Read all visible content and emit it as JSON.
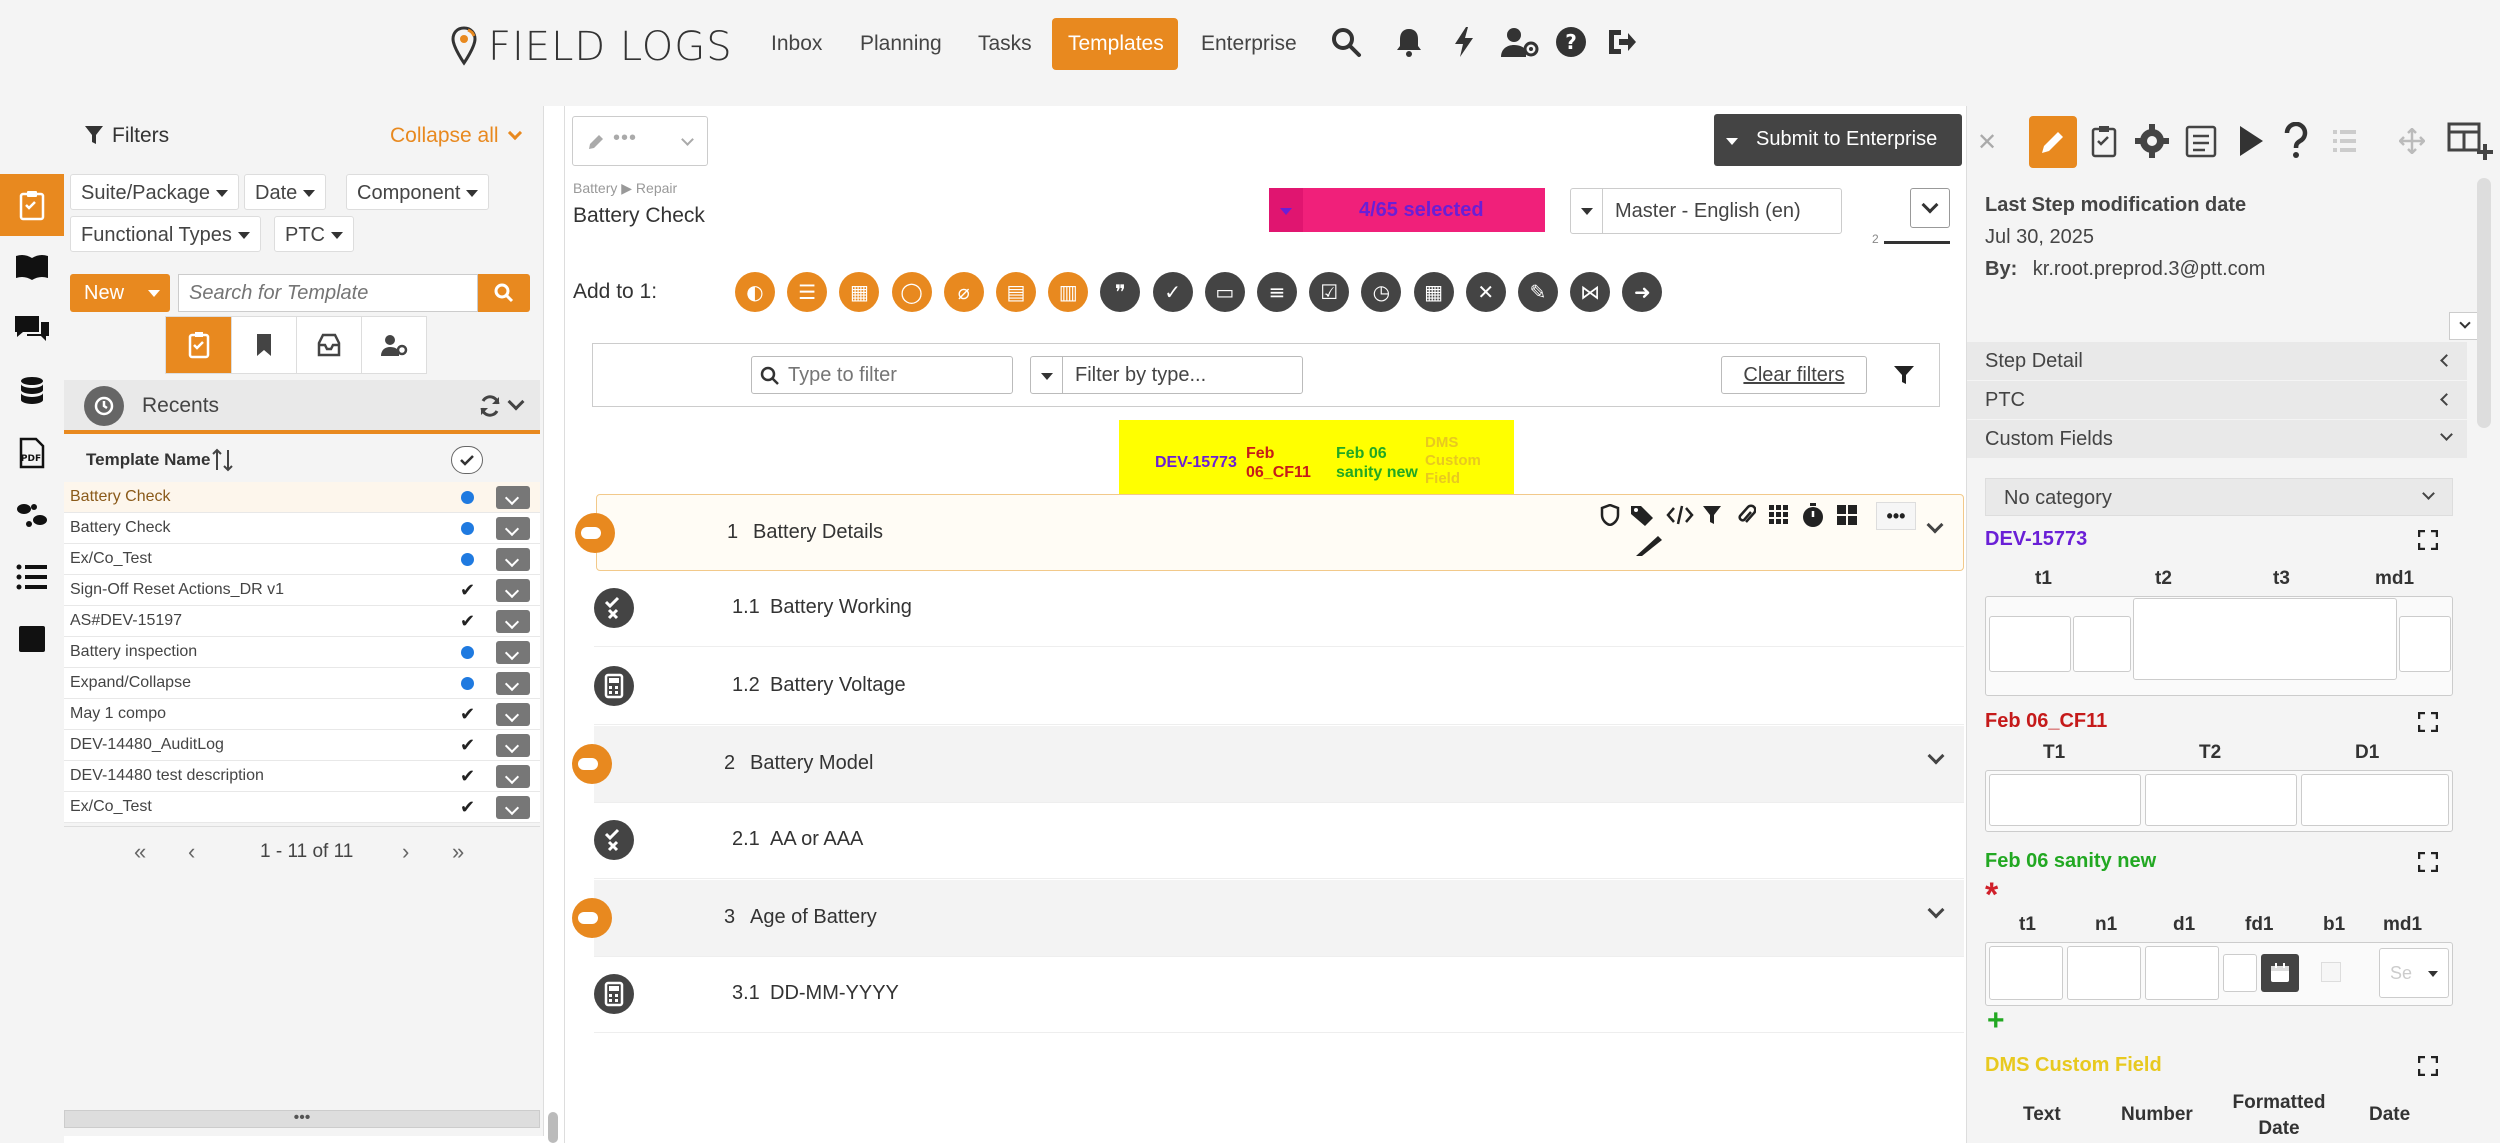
{
  "app": {
    "brand": "FIELD LOGS"
  },
  "nav": {
    "items": [
      {
        "label": "Inbox"
      },
      {
        "label": "Planning"
      },
      {
        "label": "Tasks"
      },
      {
        "label": "Templates"
      },
      {
        "label": "Enterprise"
      }
    ],
    "active": "Templates"
  },
  "filters": {
    "title": "Filters",
    "collapse_all": "Collapse all",
    "chips": [
      "Suite/Package",
      "Date",
      "Component",
      "Functional Types",
      "PTC"
    ],
    "new_label": "New",
    "search_placeholder": "Search for Template",
    "recents_label": "Recents",
    "column_header": "Template Name",
    "rows": [
      {
        "name": "Battery Check",
        "status": "dot"
      },
      {
        "name": "Battery Check",
        "status": "dot"
      },
      {
        "name": "Ex/Co_Test",
        "status": "dot"
      },
      {
        "name": "Sign-Off Reset Actions_DR v1",
        "status": "check"
      },
      {
        "name": "AS#DEV-15197",
        "status": "check"
      },
      {
        "name": "Battery inspection",
        "status": "dot"
      },
      {
        "name": "Expand/Collapse",
        "status": "dot"
      },
      {
        "name": "May 1 compo",
        "status": "check"
      },
      {
        "name": "DEV-14480_AuditLog",
        "status": "check"
      },
      {
        "name": "DEV-14480 test description",
        "status": "check"
      },
      {
        "name": "Ex/Co_Test",
        "status": "check"
      }
    ],
    "pagination": "1 - 11 of 11"
  },
  "center": {
    "submit_label": "Submit to Enterprise",
    "breadcrumb": [
      "Battery",
      "Repair"
    ],
    "template_title": "Battery Check",
    "selected_label": "4/65 selected",
    "language": "Master - English (en)",
    "small_counter": "2",
    "add_to_label": "Add to 1:",
    "filter_placeholder": "Type to filter",
    "type_placeholder": "Filter by type...",
    "clear_filters": "Clear filters",
    "legend": {
      "dev": "DEV-15773",
      "feb_cf11": "Feb 06_CF11",
      "feb_sanity": "Feb 06 sanity new",
      "dms": "DMS Custom Field"
    },
    "tree": [
      {
        "num": "1",
        "label": "Battery Details",
        "kind": "group",
        "selected": true
      },
      {
        "num": "1.1",
        "label": "Battery Working",
        "kind": "check"
      },
      {
        "num": "1.2",
        "label": "Battery Voltage",
        "kind": "calc"
      },
      {
        "num": "2",
        "label": "Battery Model",
        "kind": "group"
      },
      {
        "num": "2.1",
        "label": "AA or AAA",
        "kind": "check"
      },
      {
        "num": "3",
        "label": "Age of Battery",
        "kind": "group"
      },
      {
        "num": "3.1",
        "label": "DD-MM-YYYY",
        "kind": "calc"
      }
    ]
  },
  "right": {
    "mod_title": "Last Step modification date",
    "mod_date": "Jul 30, 2025",
    "by_label": "By:",
    "by_value": "kr.root.preprod.3@ptt.com",
    "acc_step": "Step Detail",
    "acc_ptc": "PTC",
    "acc_cf": "Custom Fields",
    "category": "No category",
    "cf1": {
      "title": "DEV-15773",
      "cols": [
        "t1",
        "t2",
        "t3",
        "md1"
      ]
    },
    "cf2": {
      "title": "Feb 06_CF11",
      "cols": [
        "T1",
        "T2",
        "D1"
      ]
    },
    "cf3": {
      "title": "Feb 06 sanity new",
      "cols": [
        "t1",
        "n1",
        "d1",
        "fd1",
        "b1",
        "md1"
      ],
      "select_placeholder": "Se"
    },
    "cf4": {
      "title": "DMS Custom Field",
      "cols": [
        "Text",
        "Number",
        "Formatted Date",
        "Date"
      ]
    }
  },
  "colors": {
    "accent": "#e8891f",
    "pink": "#f0207a",
    "dev_purple": "#6a1fd6",
    "feb_red": "#c51a1a",
    "feb_green": "#22a822",
    "dms_yellow": "#e8c91f",
    "legend_bg": "#ffff00"
  }
}
